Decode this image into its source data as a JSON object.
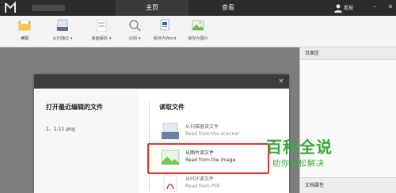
{
  "titlebar": {
    "tabs": [
      {
        "label": "主页",
        "active": true
      },
      {
        "label": "查看",
        "active": false
      }
    ],
    "user_label": "看报"
  },
  "toolbar": {
    "buttons": [
      {
        "label": "读取",
        "icon": "folder-open-icon"
      },
      {
        "label": "从扫描仪 ▾",
        "icon": "scanner-icon"
      },
      {
        "label": "版面解析 ▾",
        "icon": "layout-icon"
      },
      {
        "label": "识别 ▾",
        "icon": "magnify-icon"
      },
      {
        "label": "保存为Word",
        "icon": "save-word-icon"
      },
      {
        "label": "保存为图片",
        "icon": "save-image-icon"
      }
    ]
  },
  "right_panel": {
    "page_area_label": "页面区",
    "doc_props_label": "文档属性"
  },
  "dialog": {
    "recent_title": "打开最近编辑的文件",
    "recent_files": [
      "1、1-11.png"
    ],
    "read_title": "读取文件",
    "options": [
      {
        "title": "从扫描器读文件",
        "subtitle": "Read from the scanner",
        "icon": "scanner-icon",
        "selected": false
      },
      {
        "title": "从图片读文件",
        "subtitle": "Read from the image",
        "icon": "image-icon",
        "selected": true
      },
      {
        "title": "从PDF读文件",
        "subtitle": "Read from PDF",
        "icon": "pdf-icon",
        "selected": false
      }
    ]
  },
  "watermark": {
    "line1": "百科全说",
    "line2": "助你轻松解决"
  },
  "colors": {
    "highlight": "#d63b2f",
    "watermark": "#37a93c",
    "titlebar": "#2b2b2b"
  }
}
